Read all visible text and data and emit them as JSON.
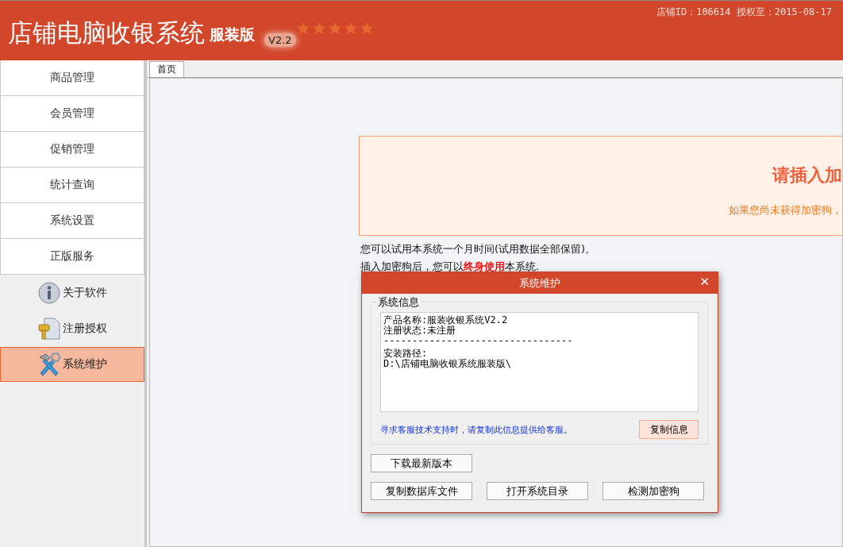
{
  "header": {
    "title": "店铺电脑收银系统",
    "edition": "服装版",
    "version": "V2.2",
    "stars": 5,
    "store_info": "店铺ID：106614 授权至：2015-08-17"
  },
  "sidebar": {
    "menu": [
      {
        "label": "商品管理",
        "selected": false
      },
      {
        "label": "会员管理",
        "selected": false
      },
      {
        "label": "促销管理",
        "selected": false
      },
      {
        "label": "统计查询",
        "selected": false
      },
      {
        "label": "系统设置",
        "selected": false
      },
      {
        "label": "正版服务",
        "selected": false
      }
    ],
    "tools": [
      {
        "label": "关于软件",
        "kind": "info",
        "selected": false
      },
      {
        "label": "注册授权",
        "kind": "key",
        "selected": false
      },
      {
        "label": "系统维护",
        "kind": "tools",
        "selected": true
      }
    ]
  },
  "tabs": [
    {
      "label": "首页",
      "selected": true
    }
  ],
  "notice": {
    "title": "请插入加",
    "subtitle": "如果您尚未获得加密狗，"
  },
  "trial_text": [
    "您可以试用本系统一个月时间(试用数据全部保留)。",
    "插入加密狗后，您可以**终身使用**本系统."
  ],
  "dialog": {
    "title": "系统维护",
    "close": "✕",
    "group_label": "系统信息",
    "info_lines": [
      "产品名称:服装收银系统V2.2",
      "注册状态:未注册",
      "---------------------------------",
      "安装路径:",
      "D:\\店铺电脑收银系统服装版\\"
    ],
    "hint": "寻求客服技术支持时，请复制此信息提供给客服。",
    "copy_button": "复制信息",
    "buttons": [
      [
        "下载最新版本"
      ],
      [
        "复制数据库文件",
        "打开系统目录",
        "检测加密狗"
      ]
    ]
  }
}
